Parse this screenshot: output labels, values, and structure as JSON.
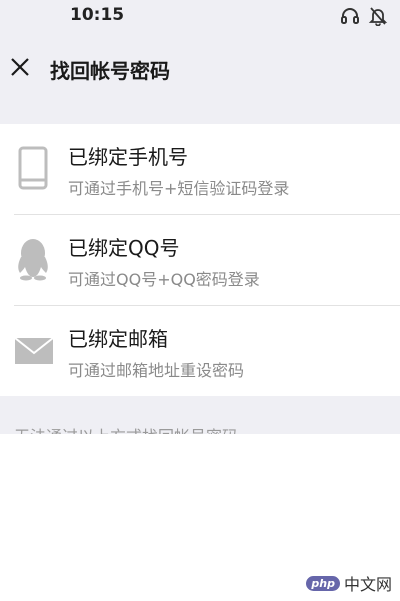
{
  "status_bar": {
    "time": "10:15"
  },
  "header": {
    "title": "找回帐号密码"
  },
  "items": [
    {
      "label": "已绑定手机号",
      "desc": "可通过手机号+短信验证码登录",
      "icon": "phone-icon"
    },
    {
      "label": "已绑定QQ号",
      "desc": "可通过QQ号+QQ密码登录",
      "icon": "qq-penguin-icon"
    },
    {
      "label": "已绑定邮箱",
      "desc": "可通过邮箱地址重设密码",
      "icon": "mail-icon"
    }
  ],
  "footer": {
    "hint": "无法通过以上方式找回帐号密码"
  },
  "watermark": {
    "badge": "php",
    "text": "中文网"
  },
  "colors": {
    "background": "#efeff4",
    "icon_gray": "#bdbdbd",
    "desc_gray": "#8a8a8a"
  }
}
